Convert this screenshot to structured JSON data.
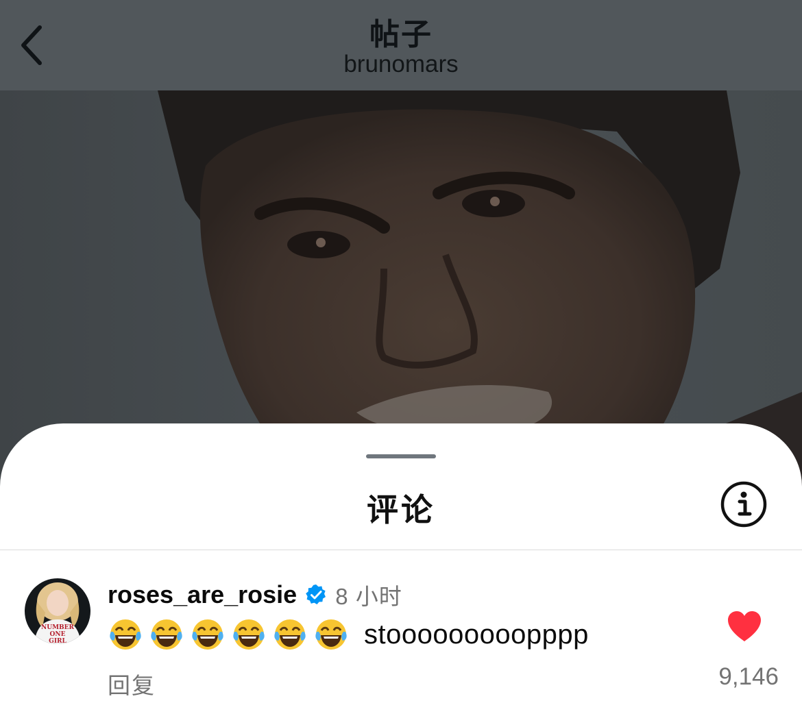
{
  "header": {
    "title": "帖子",
    "subtitle": "brunomars",
    "back_icon": "chevron-left-icon"
  },
  "comments_sheet": {
    "title": "评论",
    "info_icon": "info-circle-icon"
  },
  "comment": {
    "username": "roses_are_rosie",
    "verified": true,
    "verified_icon": "verified-badge-icon",
    "timestamp": "8 小时",
    "emoji_icon": "face-with-tears-of-joy-icon",
    "emoji_count": 6,
    "text": "stooooooooopppp",
    "reply_label": "回复",
    "like_icon": "heart-filled-icon",
    "like_count": "9,146",
    "avatar_shirt_text": "NUMBER ONE GIRL"
  },
  "colors": {
    "dim_overlay": "#51575b",
    "verified_blue": "#0095f6",
    "like_red": "#ff3040",
    "secondary_text": "#737373"
  }
}
